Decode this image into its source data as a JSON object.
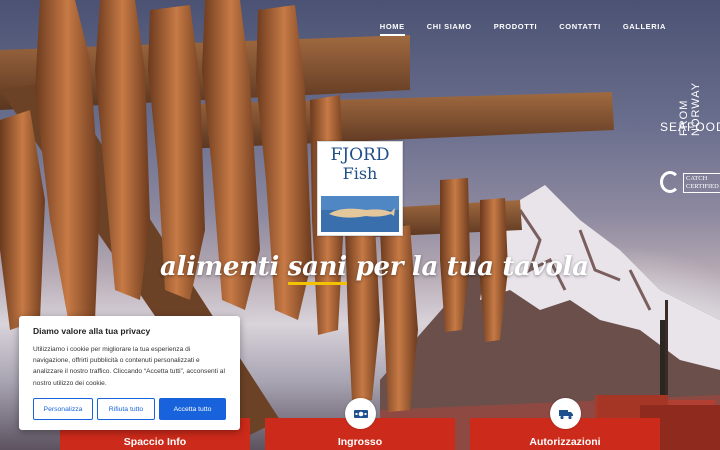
{
  "nav": {
    "items": [
      {
        "label": "HOME",
        "active": true
      },
      {
        "label": "CHI SIAMO",
        "active": false
      },
      {
        "label": "PRODOTTI",
        "active": false
      },
      {
        "label": "CONTATTI",
        "active": false
      },
      {
        "label": "GALLERIA",
        "active": false
      }
    ]
  },
  "logo": {
    "line1": "FJORD",
    "line2": "Fish"
  },
  "hero": {
    "tagline_before": "alimenti ",
    "tagline_highlight": "sani",
    "tagline_after": " per la tua tavola"
  },
  "badge": {
    "seafood": "SEAFOOD",
    "from": "FROM NORWAY",
    "catch": "CATCH CERTIFIED"
  },
  "cookie": {
    "title": "Diamo valore alla tua privacy",
    "text": "Utilizziamo i cookie per migliorare la tua esperienza di navigazione, offrirti pubblicità o contenuti personalizzati e analizzare il nostro traffico. Cliccando “Accetta tutti”, acconsenti al nostro utilizzo dei cookie.",
    "customize": "Personalizza",
    "reject": "Rifiuta tutto",
    "accept": "Accetta tutto"
  },
  "cards": [
    {
      "label": "Spaccio Info",
      "icon": "shop-icon"
    },
    {
      "label": "Ingrosso",
      "icon": "money-icon"
    },
    {
      "label": "Autorizzazioni",
      "icon": "truck-icon"
    }
  ],
  "colors": {
    "accent": "#cc2a1a",
    "cookie_button": "#1863dc",
    "highlight": "#f2c200",
    "logo_text": "#1f4f8a"
  }
}
